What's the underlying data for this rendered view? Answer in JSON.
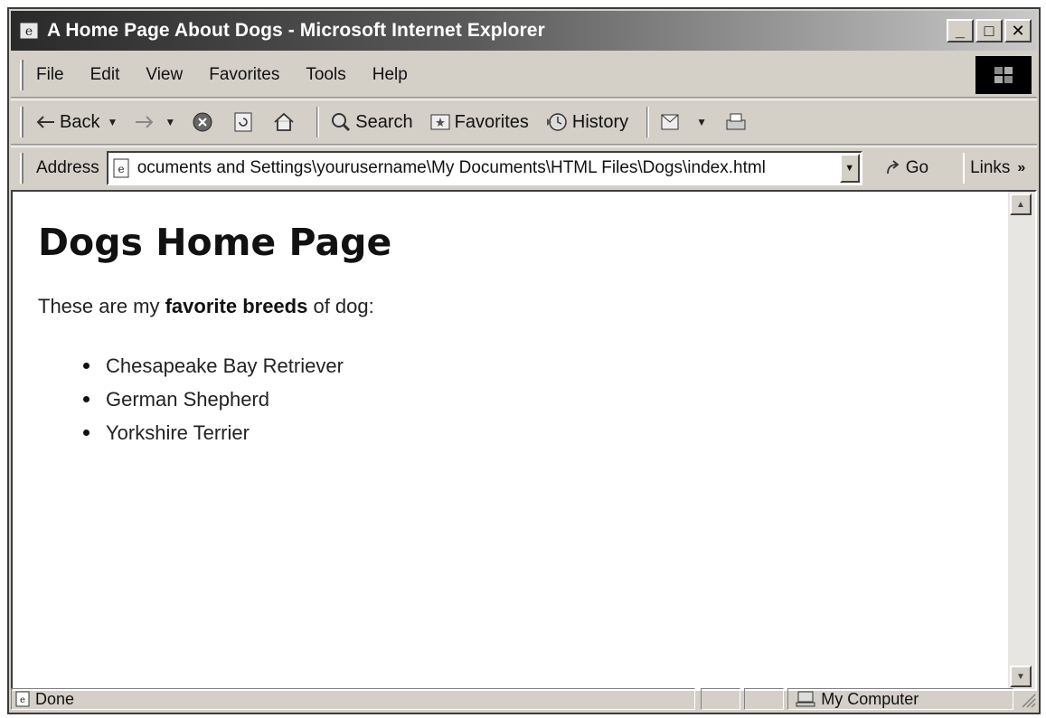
{
  "window": {
    "title": "A Home Page About Dogs - Microsoft Internet Explorer",
    "minimize_label": "_",
    "maximize_label": "□",
    "close_label": "✕"
  },
  "menu": {
    "items": [
      "File",
      "Edit",
      "View",
      "Favorites",
      "Tools",
      "Help"
    ]
  },
  "toolbar": {
    "back_label": "Back",
    "search_label": "Search",
    "favorites_label": "Favorites",
    "history_label": "History"
  },
  "address": {
    "label": "Address",
    "value": "ocuments and Settings\\yourusername\\My Documents\\HTML Files\\Dogs\\index.html",
    "go_label": "Go",
    "links_label": "Links"
  },
  "page": {
    "heading": "Dogs Home Page",
    "intro_before": "These are my ",
    "intro_bold": "favorite breeds",
    "intro_after": " of dog:",
    "breeds": [
      "Chesapeake Bay Retriever",
      "German Shepherd",
      "Yorkshire Terrier"
    ]
  },
  "status": {
    "text": "Done",
    "zone": "My Computer"
  }
}
